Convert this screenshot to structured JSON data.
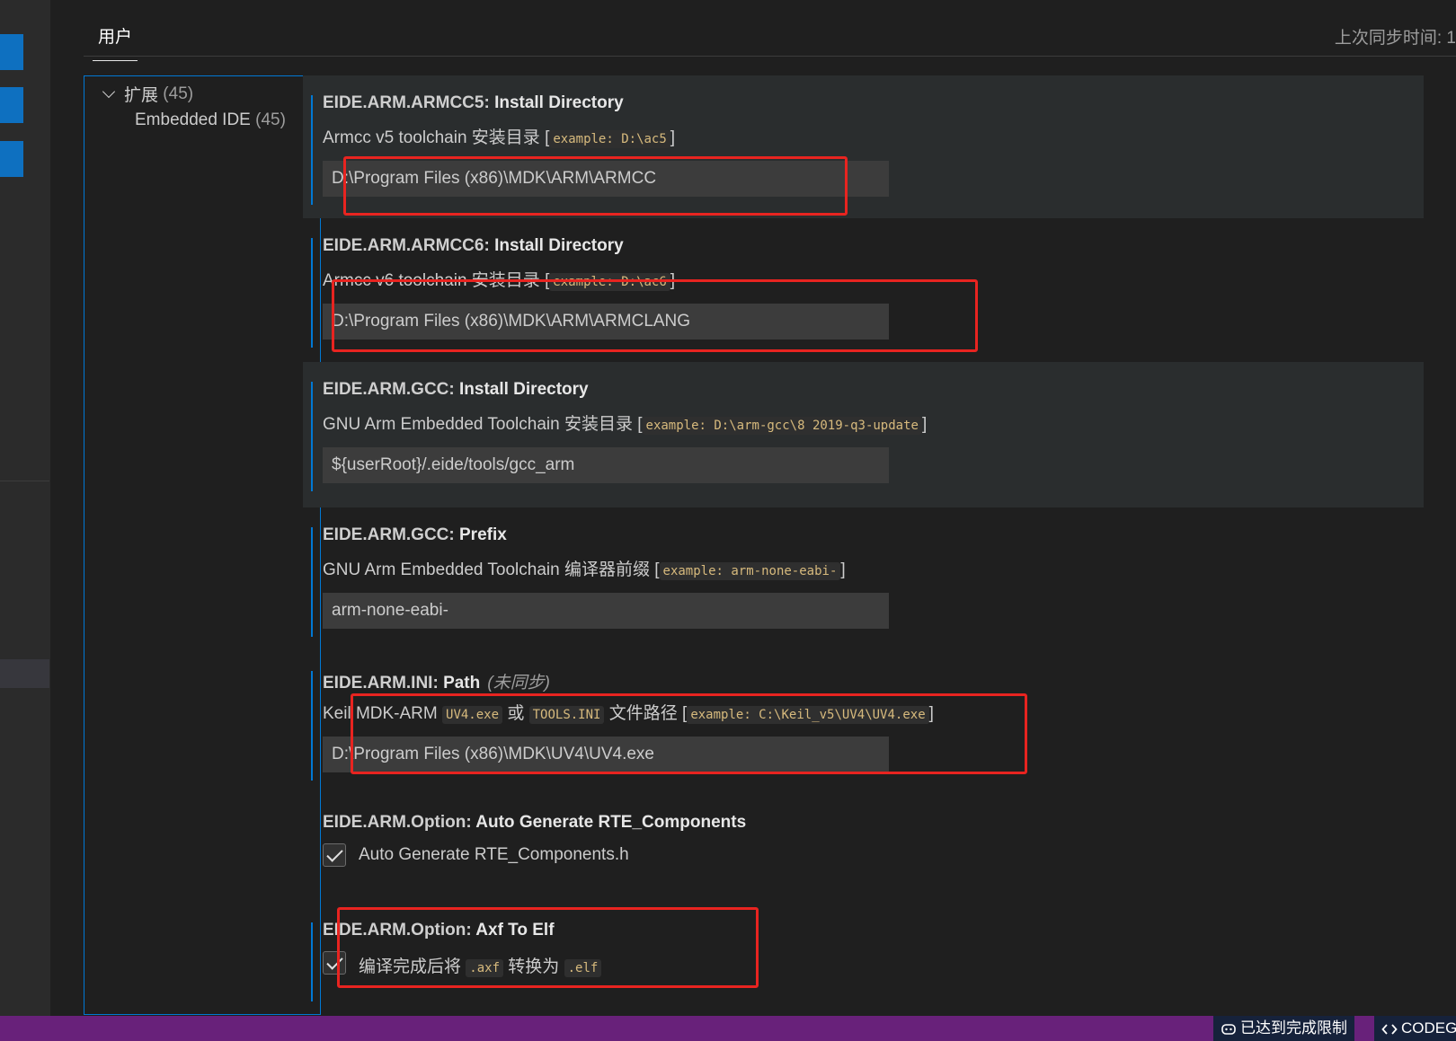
{
  "header": {
    "tab_user": "用户",
    "last_sync": "上次同步时间: 1"
  },
  "toc": {
    "group_label": "扩展",
    "group_count": "(45)",
    "item_label": "Embedded IDE",
    "item_count": "(45)"
  },
  "settings": [
    {
      "category": "EIDE.ARM.ARMCC5: ",
      "name": "Install Directory",
      "desc": "Armcc v5 toolchain 安装目录",
      "example": "example: D:\\ac5",
      "value": "D:\\Program Files (x86)\\MDK\\ARM\\ARMCC"
    },
    {
      "category": "EIDE.ARM.ARMCC6: ",
      "name": "Install Directory",
      "desc": "Armcc v6 toolchain 安装目录",
      "example": "example: D:\\ac6",
      "value": "D:\\Program Files (x86)\\MDK\\ARM\\ARMCLANG"
    },
    {
      "category": "EIDE.ARM.GCC: ",
      "name": "Install Directory",
      "desc": "GNU Arm Embedded Toolchain 安装目录",
      "example": "example: D:\\arm-gcc\\8 2019-q3-update",
      "value": "${userRoot}/.eide/tools/gcc_arm"
    },
    {
      "category": "EIDE.ARM.GCC: ",
      "name": "Prefix",
      "desc": "GNU Arm Embedded Toolchain 编译器前缀",
      "example": "example: arm-none-eabi-",
      "value": "arm-none-eabi-"
    },
    {
      "category": "EIDE.ARM.INI: ",
      "name": "Path",
      "tag": "(未同步)",
      "desc_prefix": "Keil MDK-ARM",
      "code1": "UV4.exe",
      "desc_or": "或",
      "code2": "TOOLS.INI",
      "desc_suffix": "文件路径",
      "example": "example: C:\\Keil_v5\\UV4\\UV4.exe",
      "value": "D:\\Program Files (x86)\\MDK\\UV4\\UV4.exe"
    },
    {
      "category": "EIDE.ARM.Option: ",
      "name": "Auto Generate RTE_Components",
      "check_label": "Auto Generate RTE_Components.h",
      "checked": true
    },
    {
      "category": "EIDE.ARM.Option: ",
      "name": "Axf To Elf",
      "check_prefix": "编译完成后将",
      "code1": ".axf",
      "check_mid": "转换为",
      "code2": ".elf",
      "checked": true
    }
  ],
  "statusbar": {
    "limit_label": "已达到完成限制",
    "codegeex_label": "CODEGEEX"
  },
  "colors": {
    "accent": "#0078d4",
    "status_bar": "#68217a",
    "highlight_box": "#e82420"
  },
  "icons": [
    "gear-icon",
    "chevron-down-icon",
    "copilot-icon",
    "code-icon",
    "checkbox-checked-icon"
  ]
}
